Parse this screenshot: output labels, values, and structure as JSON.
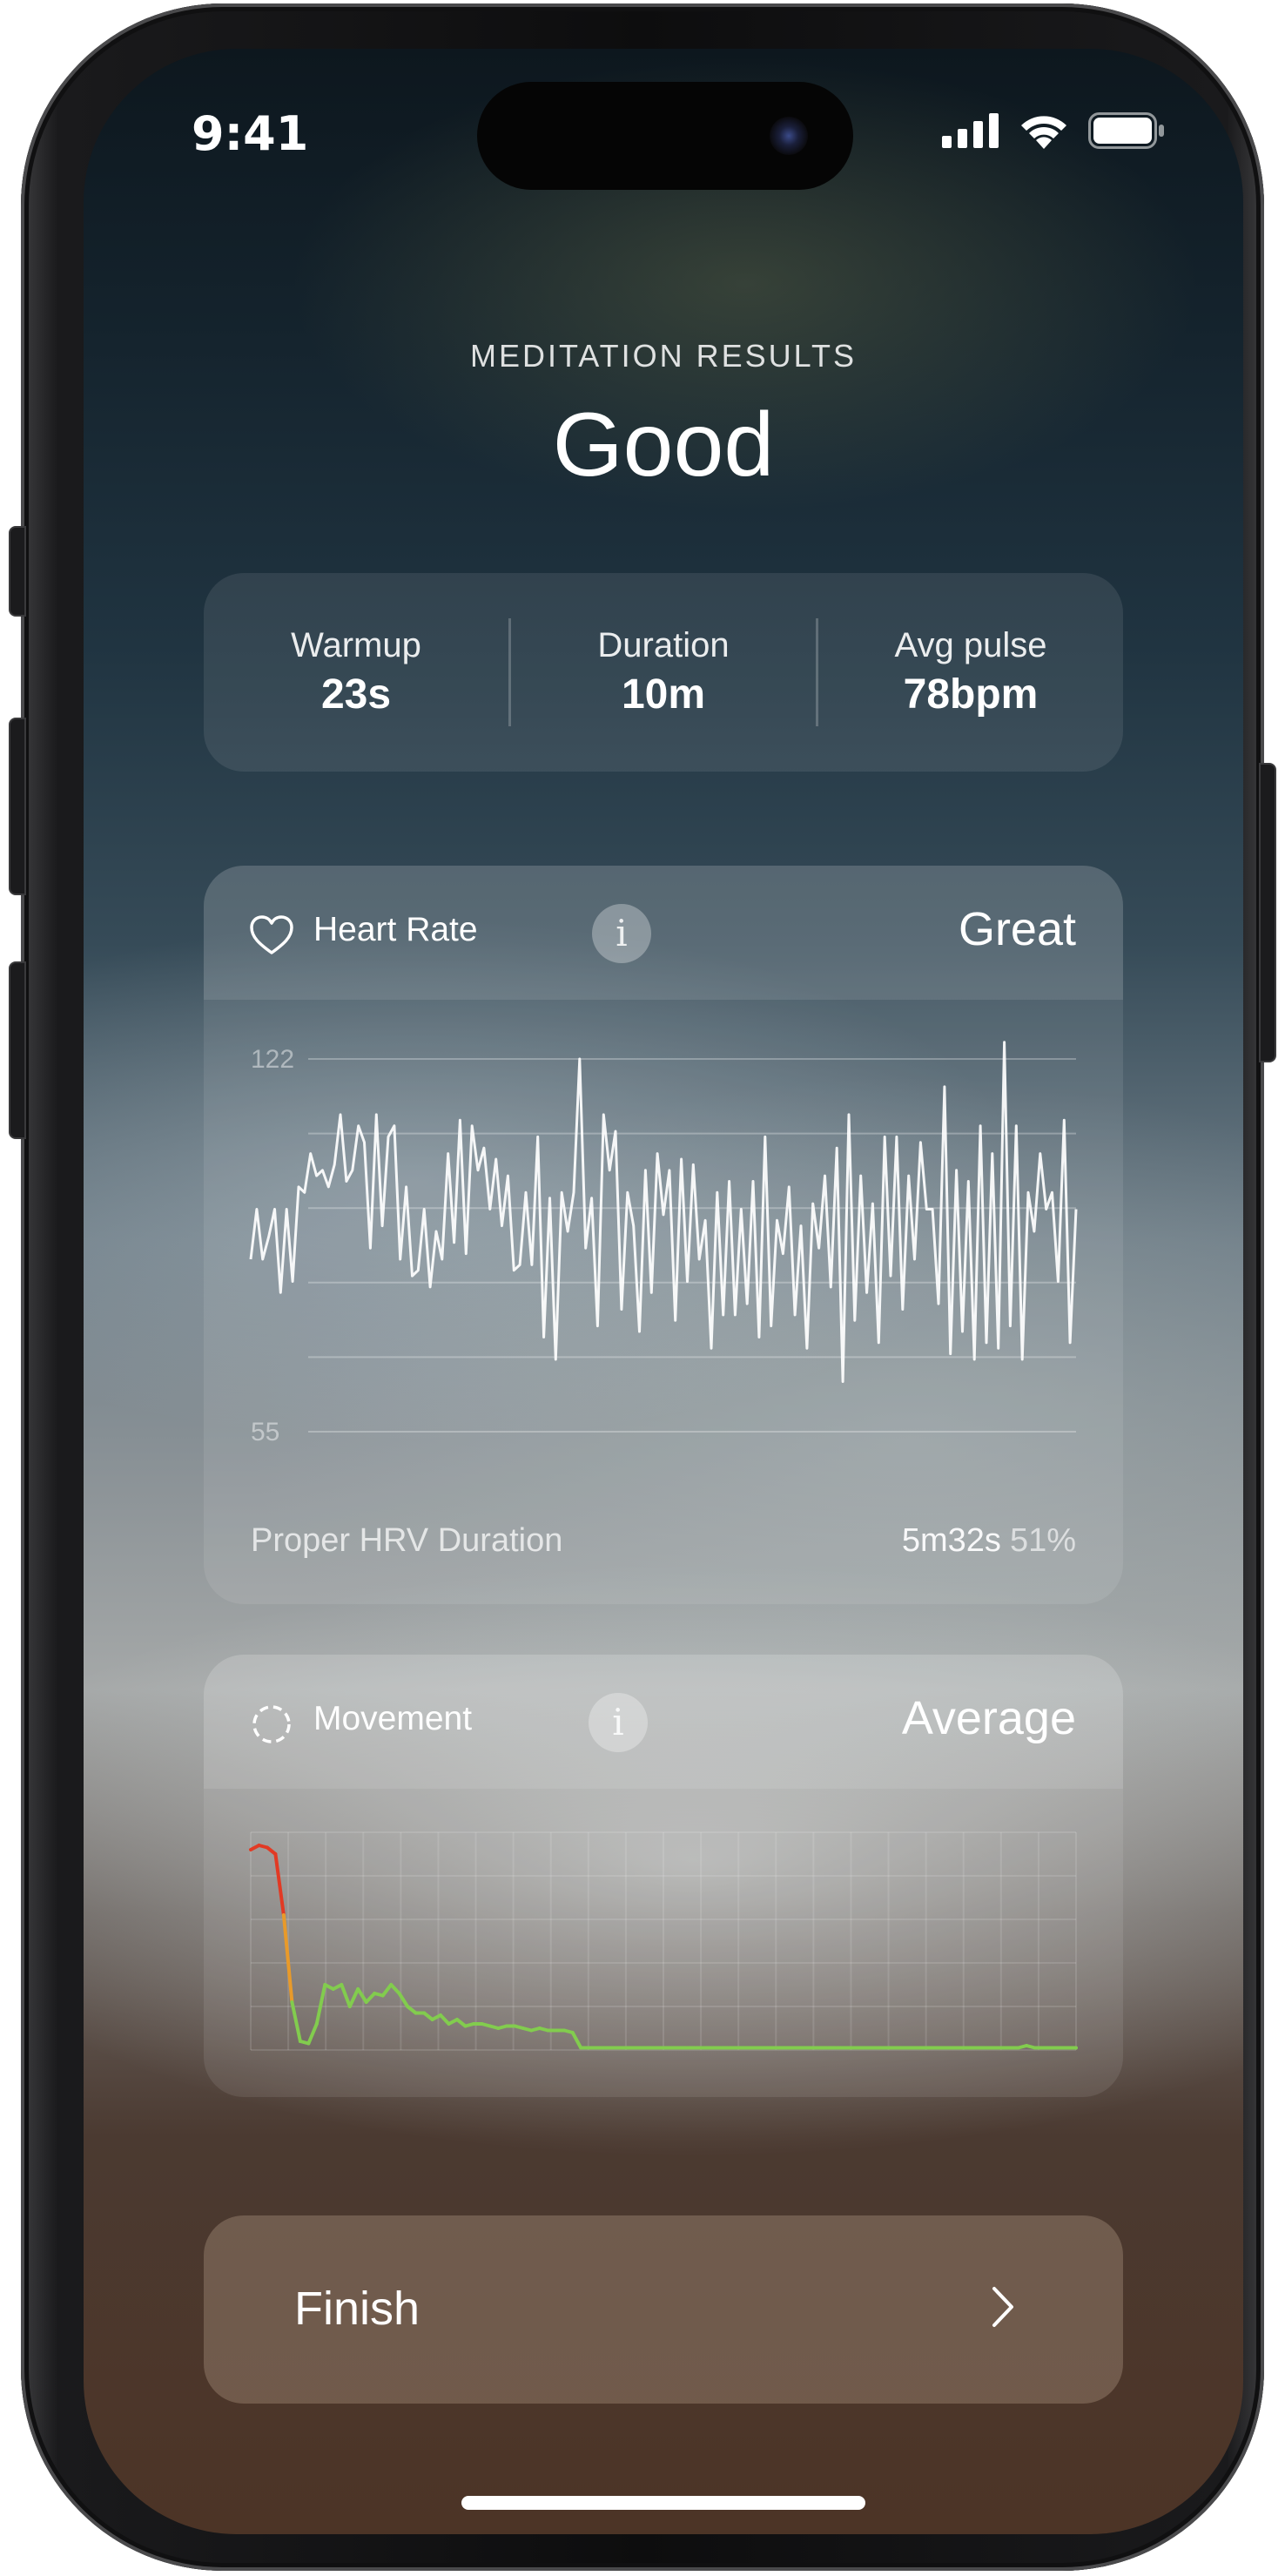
{
  "status_bar": {
    "time": "9:41"
  },
  "header": {
    "kicker": "MEDITATION RESULTS",
    "title": "Good"
  },
  "stats": [
    {
      "label": "Warmup",
      "value": "23s"
    },
    {
      "label": "Duration",
      "value": "10m"
    },
    {
      "label": "Avg pulse",
      "value": "78bpm"
    }
  ],
  "heart_rate": {
    "label": "Heart Rate",
    "info_glyph": "i",
    "rating": "Great",
    "hrv_label": "Proper HRV Duration",
    "hrv_duration": "5m32s",
    "hrv_percent": "51%"
  },
  "movement": {
    "label": "Movement",
    "info_glyph": "i",
    "rating": "Average"
  },
  "finish": {
    "label": "Finish"
  },
  "chart_data": [
    {
      "type": "line",
      "series": [
        {
          "values": [
            86,
            95,
            86,
            90,
            95,
            80,
            95,
            82,
            99,
            98,
            105,
            101,
            102,
            99,
            103,
            112,
            100,
            102,
            110,
            107,
            88,
            112,
            92,
            108,
            110,
            86,
            99,
            83,
            84,
            95,
            81,
            91,
            86,
            105,
            89,
            111,
            87,
            110,
            102,
            106,
            95,
            104,
            92,
            101,
            84,
            85,
            98,
            85,
            108,
            72,
            97,
            68,
            98,
            91,
            98,
            122,
            88,
            97,
            74,
            112,
            102,
            109,
            77,
            98,
            92,
            73,
            102,
            80,
            105,
            94,
            102,
            75,
            104,
            82,
            103,
            86,
            93,
            70,
            98,
            76,
            100,
            76,
            95,
            78,
            100,
            72,
            108,
            74,
            93,
            87,
            99,
            76,
            92,
            70,
            96,
            88,
            101,
            81,
            106,
            64,
            112,
            75,
            101,
            80,
            96,
            71,
            108,
            83,
            108,
            77,
            101,
            86,
            107,
            95,
            95,
            78,
            117,
            69,
            102,
            73,
            100,
            68,
            110,
            71,
            105,
            70,
            125,
            74,
            110,
            68,
            98,
            91,
            105,
            95,
            98,
            82,
            111,
            71,
            95
          ]
        }
      ],
      "y_tick_labels": [
        "122",
        "55"
      ],
      "ylim": [
        55,
        122
      ],
      "gridlines": 6
    },
    {
      "type": "line",
      "series": [
        {
          "values": [
            92,
            94,
            93,
            90,
            62,
            22,
            4,
            3,
            12,
            30,
            28,
            30,
            20,
            28,
            22,
            26,
            25,
            30,
            26,
            20,
            17,
            17,
            14,
            16,
            12,
            14,
            11,
            12,
            12,
            11,
            10,
            11,
            11,
            10,
            9,
            10,
            9,
            9,
            9,
            8,
            1,
            1,
            1,
            1,
            1,
            1,
            1,
            1,
            1,
            1,
            1,
            1,
            1,
            1,
            1,
            1,
            1,
            1,
            1,
            1,
            1,
            1,
            1,
            1,
            1,
            1,
            1,
            1,
            1,
            1,
            1,
            1,
            1,
            1,
            1,
            1,
            1,
            1,
            1,
            1,
            1,
            1,
            1,
            1,
            1,
            1,
            1,
            1,
            1,
            1,
            1,
            1,
            1,
            1,
            2,
            1,
            1,
            1,
            1,
            1,
            1
          ]
        }
      ],
      "ylim": [
        0,
        100
      ],
      "colors": {
        "high": "#e23a24",
        "mid": "#e89a2a",
        "low": "#82cc4e"
      }
    }
  ]
}
